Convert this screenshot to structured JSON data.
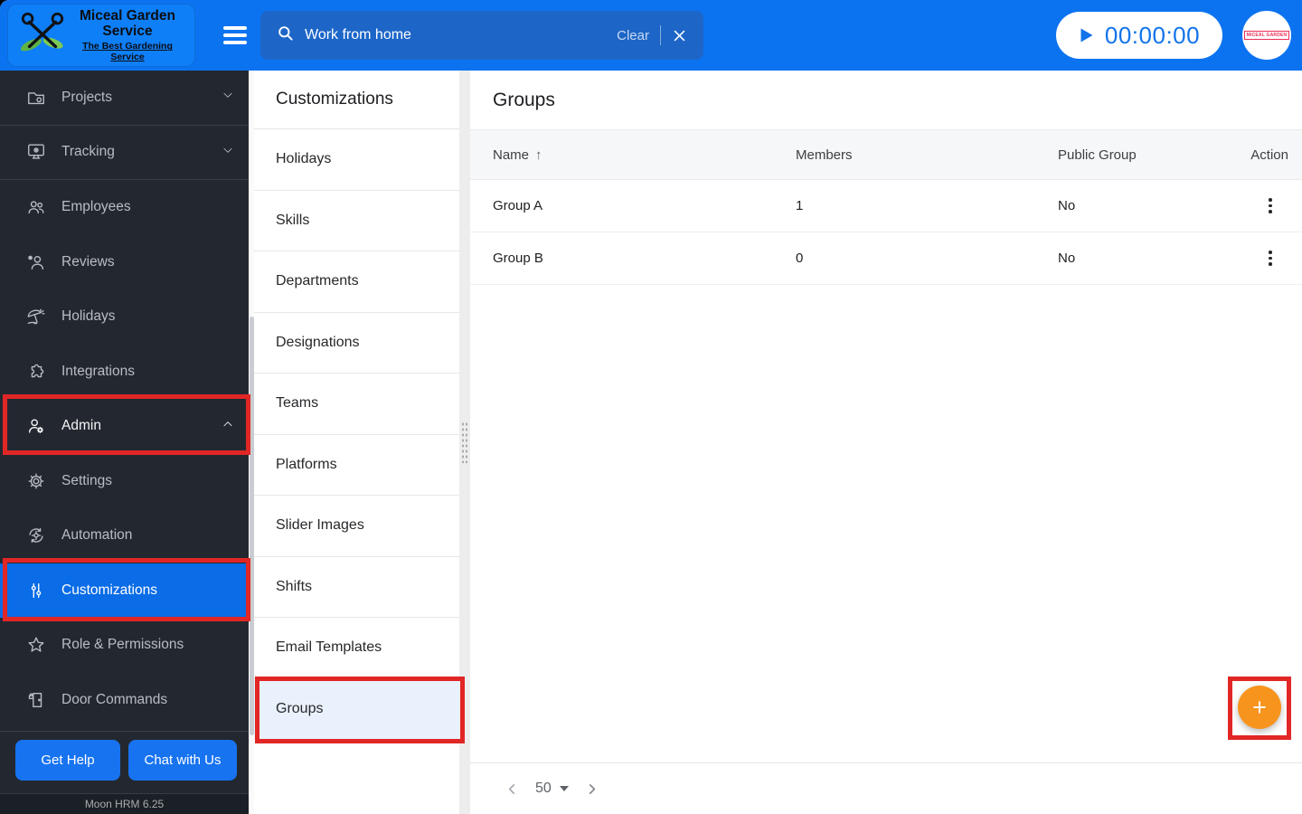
{
  "colors": {
    "topbar_blue": "#0c73f0",
    "logo_blue": "#0f7ff8",
    "search_blue": "#1d66c8",
    "active_blue": "#0a6ce6",
    "button_blue": "#1773f0",
    "timer_blue": "#1273eb",
    "annotation_red": "#e12726",
    "fab_orange": "#f7941d",
    "groups_highlight": "#e9f2fc"
  },
  "topbar": {
    "logo": {
      "title": "Miceal Garden Service",
      "tagline": "The Best Gardening Service"
    },
    "search": {
      "value": "Work from home",
      "clear_label": "Clear"
    },
    "timer": {
      "value": "00:00:00"
    },
    "avatar_text": "MICEAL GARDEN"
  },
  "sidebar": {
    "items": [
      {
        "label": "Projects",
        "icon": "folder-icon",
        "chevron": "down"
      },
      {
        "label": "Tracking",
        "icon": "monitor-icon",
        "chevron": "down"
      },
      {
        "label": "Employees",
        "icon": "employees-icon"
      },
      {
        "label": "Reviews",
        "icon": "reviews-icon"
      },
      {
        "label": "Holidays",
        "icon": "holidays-icon"
      },
      {
        "label": "Integrations",
        "icon": "integrations-icon"
      },
      {
        "label": "Admin",
        "icon": "admin-icon",
        "chevron": "up",
        "annotated": true
      },
      {
        "label": "Settings",
        "icon": "settings-icon"
      },
      {
        "label": "Automation",
        "icon": "automation-icon"
      },
      {
        "label": "Customizations",
        "icon": "customizations-icon",
        "active": true,
        "annotated": true
      },
      {
        "label": "Role & Permissions",
        "icon": "role-permissions-icon"
      },
      {
        "label": "Door Commands",
        "icon": "door-commands-icon"
      }
    ],
    "get_help_label": "Get Help",
    "chat_label": "Chat with Us",
    "version": "Moon HRM 6.25"
  },
  "subpanel": {
    "title": "Customizations",
    "items": [
      "Holidays",
      "Skills",
      "Departments",
      "Designations",
      "Teams",
      "Platforms",
      "Slider Images",
      "Shifts",
      "Email Templates",
      "Groups"
    ],
    "active_item": "Groups"
  },
  "main": {
    "title": "Groups",
    "table": {
      "columns": [
        "Name",
        "Members",
        "Public Group",
        "Action"
      ],
      "sorted_column": "Name",
      "sort_direction": "asc",
      "rows": [
        {
          "name": "Group A",
          "members": "1",
          "public_group": "No"
        },
        {
          "name": "Group B",
          "members": "0",
          "public_group": "No"
        }
      ]
    },
    "pagination": {
      "page_size": "50"
    },
    "fab_label": "+"
  }
}
